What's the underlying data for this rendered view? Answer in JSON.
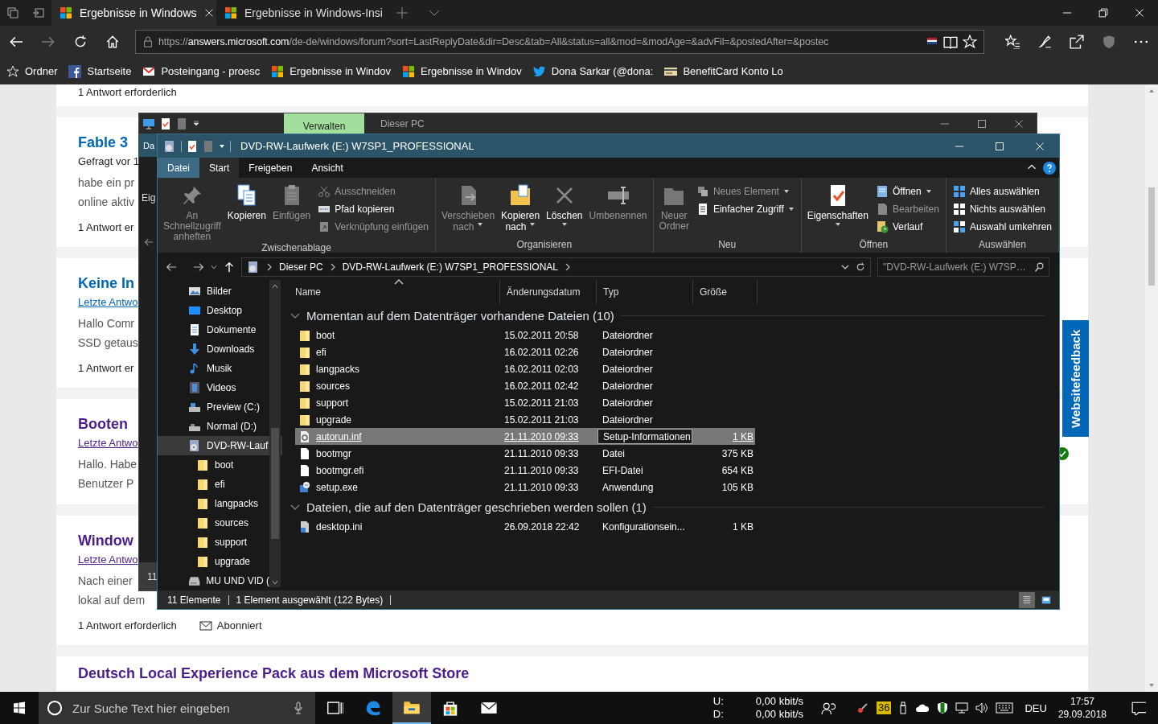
{
  "browser": {
    "tabs": [
      {
        "title": "Ergebnisse in Windows",
        "selected": true
      },
      {
        "title": "Ergebnisse in Windows-Insi",
        "selected": false
      }
    ],
    "address": "https://**answers.microsoft.com**/de-de/windows/forum?sort=LastReplyDate&dir=Desc&tab=All&status=all&mod=&modAge=&advFil=&postedAfter=&postec",
    "favorites": [
      "Ordner",
      "Startseite",
      "Posteingang - proesc",
      "Ergebnisse in Windov",
      "Ergebnisse in Windov",
      "Dona Sarkar (@dona:",
      "BenefitCard Konto Lo"
    ]
  },
  "page": {
    "cards": [
      {
        "footer": [
          {
            "kind": "replies",
            "text": "1 Antwort erforderlich"
          }
        ]
      },
      {
        "title": "Fable 3",
        "visited": false,
        "answered": false,
        "meta": "Gefragt vor 1",
        "excerpt": [
          "habe ein pr",
          "online aktiv"
        ],
        "footer": [
          {
            "kind": "replies",
            "text": "1 Antwort er"
          }
        ]
      },
      {
        "title": "Keine In",
        "visited": false,
        "answered": false,
        "link": "Letzte Antwo",
        "excerpt": [
          "Hallo Comr",
          "SSD getaus"
        ],
        "footer": [
          {
            "kind": "replies",
            "text": "1 Antwort er"
          }
        ]
      },
      {
        "title": "Booten",
        "visited": true,
        "answered": true,
        "link": "Letzte Antwo",
        "excerpt": [
          "Hallo. Habe",
          "Benutzer P"
        ]
      },
      {
        "title": "Window",
        "visited": true,
        "answered": false,
        "link": "Letzte Antwo",
        "excerpt": [
          "Nach einer",
          "lokal auf dem"
        ],
        "footer": [
          {
            "kind": "replies",
            "text": "1 Antwort erforderlich"
          },
          {
            "kind": "subscription",
            "text": "Abonniert"
          }
        ]
      },
      {
        "title": "Deutsch Local Experience Pack aus dem Microsoft Store",
        "visited": true,
        "answered": false
      }
    ],
    "feedback_tab": "Websitefeedback"
  },
  "back_window": {
    "tab": "Verwalten",
    "title": "Dieser PC",
    "tab_fragment": "Da",
    "ribbon_fragment": "Eig",
    "status_fragment": "11"
  },
  "explorer": {
    "title": "DVD-RW-Laufwerk (E:) W7SP1_PROFESSIONAL",
    "tabs": [
      {
        "label": "Datei",
        "kind": "menu",
        "selected": false
      },
      {
        "label": "Start",
        "kind": "tab",
        "selected": true
      },
      {
        "label": "Freigeben",
        "kind": "tab",
        "selected": false
      },
      {
        "label": "Ansicht",
        "kind": "tab",
        "selected": false
      }
    ],
    "ribbon_groups": [
      {
        "label": "Zwischenablage",
        "items": [
          {
            "kind": "large",
            "label": "An Schnellzugriff\nanheften",
            "disabled": true
          },
          {
            "kind": "large",
            "label": "Kopieren",
            "disabled": false
          },
          {
            "kind": "large",
            "label": "Einfügen",
            "disabled": true
          },
          {
            "kind": "small",
            "label": "Ausschneiden",
            "disabled": true
          },
          {
            "kind": "small",
            "label": "Pfad kopieren",
            "disabled": false
          },
          {
            "kind": "small",
            "label": "Verknüpfung einfügen",
            "disabled": true
          }
        ]
      },
      {
        "label": "Organisieren",
        "items": [
          {
            "kind": "large",
            "label": "Verschieben\nnach",
            "disabled": true,
            "dropdown": true
          },
          {
            "kind": "large",
            "label": "Kopieren\nnach",
            "disabled": false,
            "dropdown": true
          },
          {
            "kind": "large",
            "label": "Löschen",
            "disabled": false,
            "dropdown": true
          },
          {
            "kind": "large",
            "label": "Umbenennen",
            "disabled": true
          }
        ]
      },
      {
        "label": "Neu",
        "items": [
          {
            "kind": "large",
            "label": "Neuer\nOrdner",
            "disabled": true
          },
          {
            "kind": "small",
            "label": "Neues Element",
            "disabled": true,
            "dropdown": true
          },
          {
            "kind": "small",
            "label": "Einfacher Zugriff",
            "disabled": false,
            "dropdown": true
          }
        ]
      },
      {
        "label": "Öffnen",
        "items": [
          {
            "kind": "large",
            "label": "Eigenschaften",
            "disabled": false,
            "dropdown": true
          },
          {
            "kind": "small",
            "label": "Öffnen",
            "disabled": false,
            "dropdown": true
          },
          {
            "kind": "small",
            "label": "Bearbeiten",
            "disabled": true
          },
          {
            "kind": "small",
            "label": "Verlauf",
            "disabled": false
          }
        ]
      },
      {
        "label": "Auswählen",
        "items": [
          {
            "kind": "small",
            "label": "Alles auswählen",
            "disabled": false
          },
          {
            "kind": "small",
            "label": "Nichts auswählen",
            "disabled": false
          },
          {
            "kind": "small",
            "label": "Auswahl umkehren",
            "disabled": false
          }
        ]
      }
    ],
    "breadcrumb": [
      "Dieser PC",
      "DVD-RW-Laufwerk (E:) W7SP1_PROFESSIONAL"
    ],
    "search_placeholder": "\"DVD-RW-Laufwerk (E:) W7SP…",
    "nav": [
      {
        "label": "Bilder",
        "selected": false
      },
      {
        "label": "Desktop",
        "selected": false
      },
      {
        "label": "Dokumente",
        "selected": false
      },
      {
        "label": "Downloads",
        "selected": false
      },
      {
        "label": "Musik",
        "selected": false
      },
      {
        "label": "Videos",
        "selected": false
      },
      {
        "label": "Preview (C:)",
        "selected": false
      },
      {
        "label": "Normal (D:)",
        "selected": false
      },
      {
        "label": "DVD-RW-Lauf",
        "selected": true,
        "children": [
          {
            "label": "boot",
            "selected": false
          },
          {
            "label": "efi",
            "selected": false
          },
          {
            "label": "langpacks",
            "selected": false
          },
          {
            "label": "sources",
            "selected": false
          },
          {
            "label": "support",
            "selected": false
          },
          {
            "label": "upgrade",
            "selected": false
          }
        ]
      },
      {
        "label": "MU UND VID (",
        "selected": false
      }
    ],
    "columns": [
      {
        "label": "Name",
        "sorted": true
      },
      {
        "label": "Änderungsdatum",
        "sorted": false
      },
      {
        "label": "Typ",
        "sorted": false
      },
      {
        "label": "Größe",
        "sorted": false
      }
    ],
    "groups": [
      {
        "label": "Momentan auf dem Datenträger vorhandene Dateien (10)",
        "expanded": true,
        "rows": [
          {
            "kind": "folder",
            "name": "boot",
            "date": "15.02.2011 20:58",
            "type": "Dateiordner",
            "selected": false
          },
          {
            "kind": "folder",
            "name": "efi",
            "date": "16.02.2011 02:26",
            "type": "Dateiordner",
            "selected": false
          },
          {
            "kind": "folder",
            "name": "langpacks",
            "date": "16.02.2011 02:03",
            "type": "Dateiordner",
            "selected": false
          },
          {
            "kind": "folder",
            "name": "sources",
            "date": "16.02.2011 02:42",
            "type": "Dateiordner",
            "selected": false
          },
          {
            "kind": "folder",
            "name": "support",
            "date": "15.02.2011 21:03",
            "type": "Dateiordner",
            "selected": false
          },
          {
            "kind": "folder",
            "name": "upgrade",
            "date": "15.02.2011 21:03",
            "type": "Dateiordner",
            "selected": false
          },
          {
            "kind": "settings-file",
            "name": "autorun.inf",
            "date": "21.11.2010 09:33",
            "type": "Setup-Informationen",
            "size": "1 KB",
            "selected": true
          },
          {
            "kind": "file",
            "name": "bootmgr",
            "date": "21.11.2010 09:33",
            "type": "Datei",
            "size": "375 KB",
            "selected": false
          },
          {
            "kind": "file",
            "name": "bootmgr.efi",
            "date": "21.11.2010 09:33",
            "type": "EFI-Datei",
            "size": "654 KB",
            "selected": false
          },
          {
            "kind": "installer",
            "name": "setup.exe",
            "date": "21.11.2010 09:33",
            "type": "Anwendung",
            "size": "105 KB",
            "selected": false
          }
        ]
      },
      {
        "label": "Dateien, die auf den Datenträger geschrieben werden sollen (1)",
        "expanded": true,
        "rows": [
          {
            "kind": "config-file",
            "name": "desktop.ini",
            "date": "26.09.2018 22:42",
            "type": "Konfigurationsein...",
            "size": "1 KB",
            "selected": false
          }
        ]
      }
    ],
    "status": {
      "count": "11 Elemente",
      "selection": "1 Element ausgewählt (122 Bytes)",
      "views": [
        {
          "kind": "details",
          "selected": true
        },
        {
          "kind": "tiles",
          "selected": false
        }
      ]
    }
  },
  "taskbar": {
    "search_placeholder": "Zur Suche Text hier eingeben",
    "apps": [
      {
        "selected": false
      },
      {
        "selected": false
      },
      {
        "selected": true
      },
      {
        "selected": false
      },
      {
        "selected": false
      }
    ],
    "network": [
      {
        "label": "U:",
        "value": "0,00 kbit/s"
      },
      {
        "label": "D:",
        "value": "0,00 kbit/s"
      }
    ],
    "tray_badge": "36",
    "language": "DEU",
    "time": "17:57",
    "date": "29.09.2018"
  }
}
